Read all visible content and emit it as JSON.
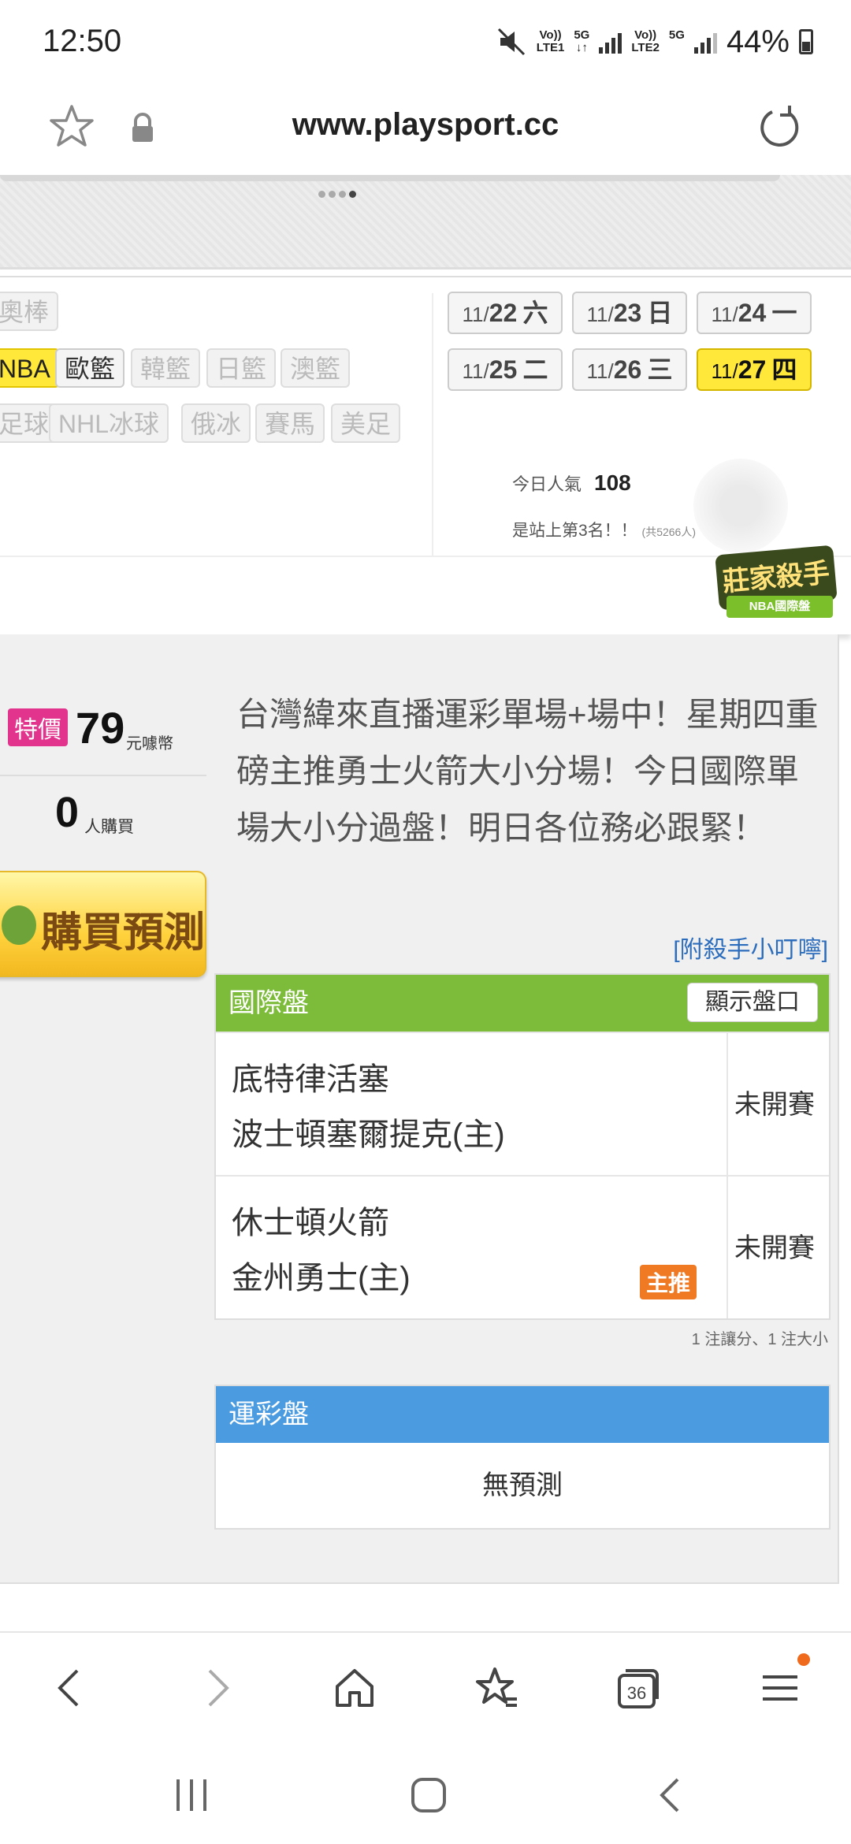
{
  "status": {
    "time": "12:50",
    "net1": "Vo))\nLTE1",
    "net1_label": "Vo))",
    "net1_sub": "LTE1",
    "fiveg1": "5G",
    "net2_label": "Vo))",
    "net2_sub": "LTE2",
    "fiveg2": "5G",
    "battery": "44%"
  },
  "browser": {
    "url": "www.playsport.cc"
  },
  "sports": {
    "row1": [
      "奧棒"
    ],
    "row2": [
      "NBA",
      "歐籃",
      "韓籃",
      "日籃",
      "澳籃"
    ],
    "row3": [
      "足球",
      "NHL冰球",
      "俄冰",
      "賽馬",
      "美足"
    ]
  },
  "dates": [
    {
      "md": "11/",
      "d": "22",
      "wd": "六"
    },
    {
      "md": "11/",
      "d": "23",
      "wd": "日"
    },
    {
      "md": "11/",
      "d": "24",
      "wd": "一"
    },
    {
      "md": "11/",
      "d": "25",
      "wd": "二"
    },
    {
      "md": "11/",
      "d": "26",
      "wd": "三"
    },
    {
      "md": "11/",
      "d": "27",
      "wd": "四"
    }
  ],
  "popularity": {
    "label": "今日人氣",
    "value": "108",
    "rank": "是站上第3名！！",
    "total": "(共5266人)"
  },
  "badge": {
    "title": "莊家殺手",
    "subtitle": "NBA國際盤"
  },
  "offer": {
    "special": "特價",
    "price": "79",
    "unit": "元噱幣",
    "buyers": "0",
    "buyers_unit": "人購買",
    "buy_label": "購買預測"
  },
  "description": "台灣緯來直播運彩單場+場中！星期四重磅主推勇士火箭大小分場！今日國際單場大小分過盤！明日各位務必跟緊！",
  "attachment": "[附殺手小叮嚀]",
  "intl": {
    "title": "國際盤",
    "show_btn": "顯示盤口",
    "games": [
      {
        "away": "底特律活塞",
        "home": "波士頓塞爾提克(主)",
        "status": "未開賽",
        "tag": ""
      },
      {
        "away": "休士頓火箭",
        "home": "金州勇士(主)",
        "status": "未開賽",
        "tag": "主推"
      }
    ],
    "note": "1 注讓分、1 注大小"
  },
  "lottery": {
    "title": "運彩盤",
    "empty": "無預測"
  },
  "toolbar": {
    "tabs_count": "36"
  },
  "colors": {
    "accent_green": "#7cbc3a",
    "accent_blue": "#4a9be0",
    "highlight": "#ffe83a",
    "special_pink": "#e2348c",
    "tag_orange": "#f07a24"
  }
}
